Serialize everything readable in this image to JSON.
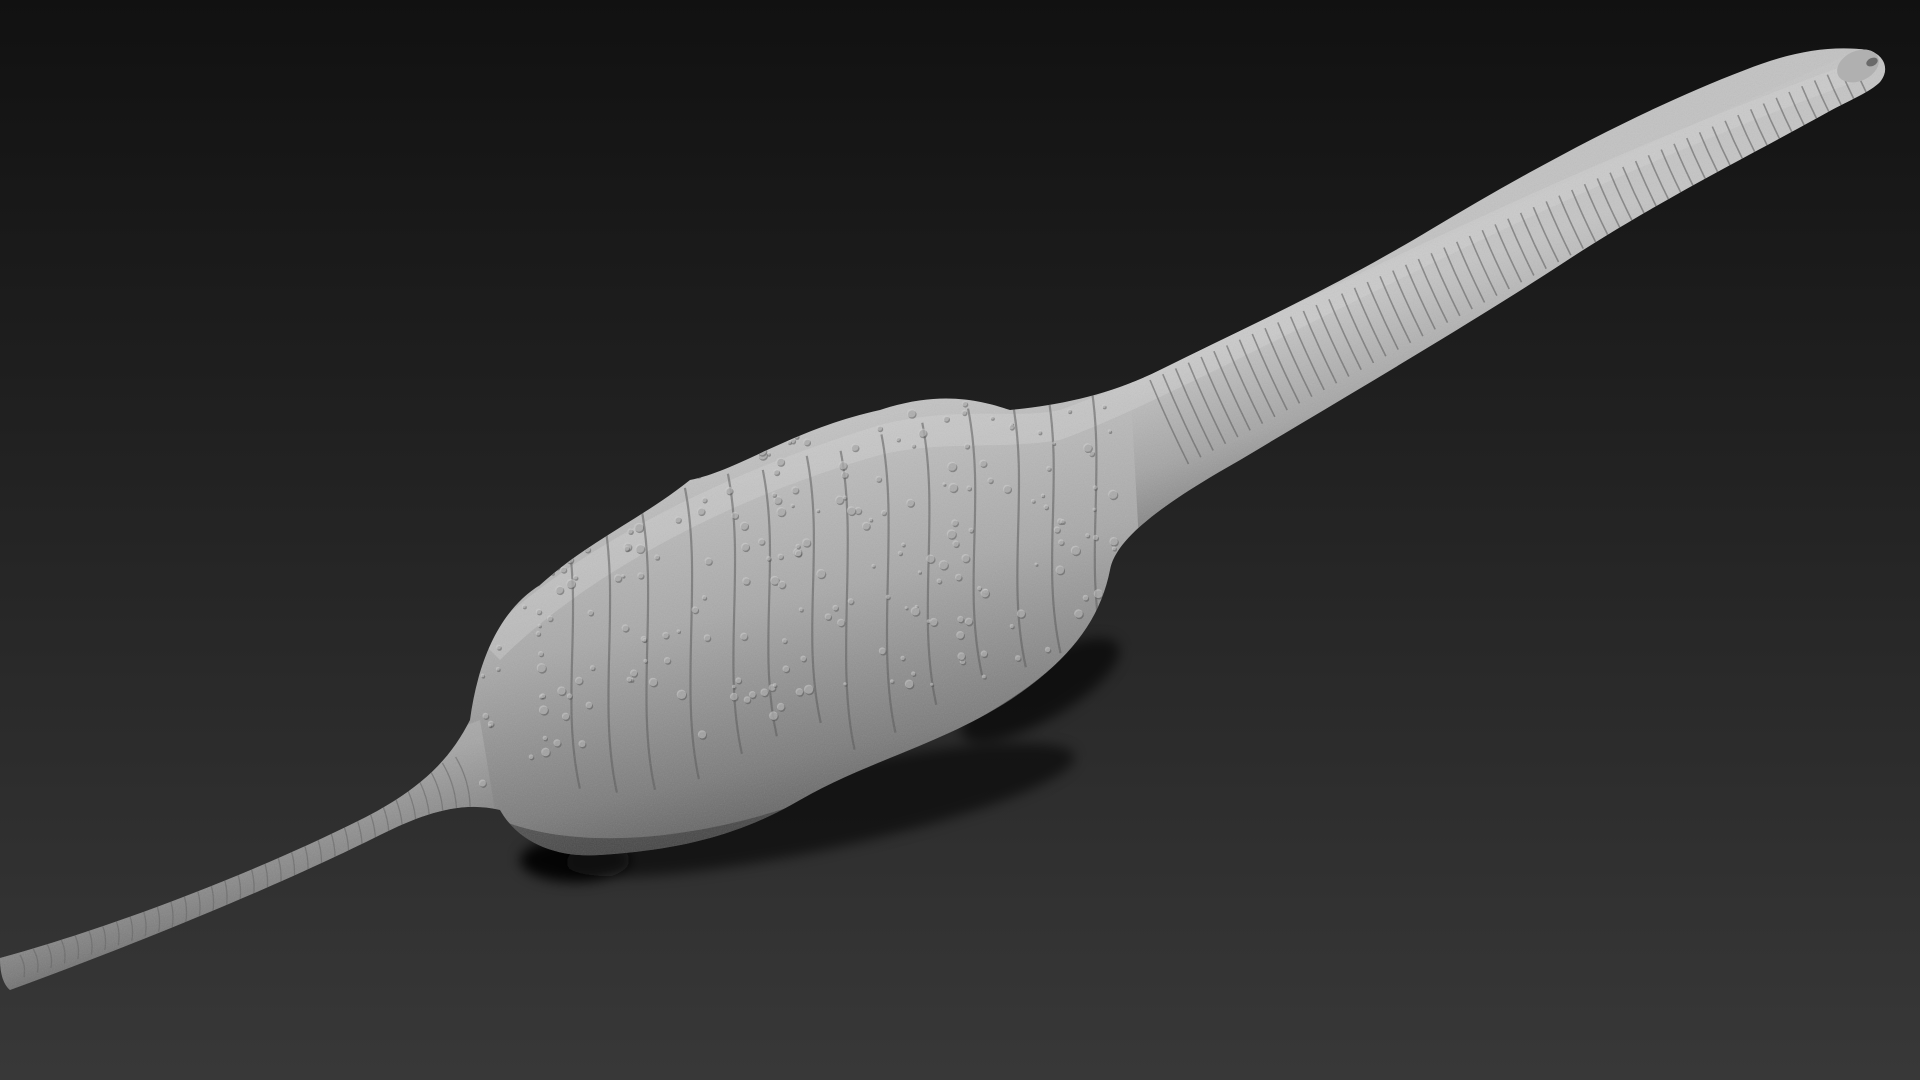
{
  "scene": {
    "kind": "3d-sculpt-render",
    "subject": "sauropod-dinosaur-body-sculpt",
    "material": "matte-grey-clay",
    "colors": {
      "background_top": "#111111",
      "background_bottom": "#383838",
      "clay_light": "#b9b9b9",
      "clay_mid": "#8a8a8a",
      "clay_dark": "#3c3c3c",
      "shadow": "#0c0c0c"
    }
  }
}
